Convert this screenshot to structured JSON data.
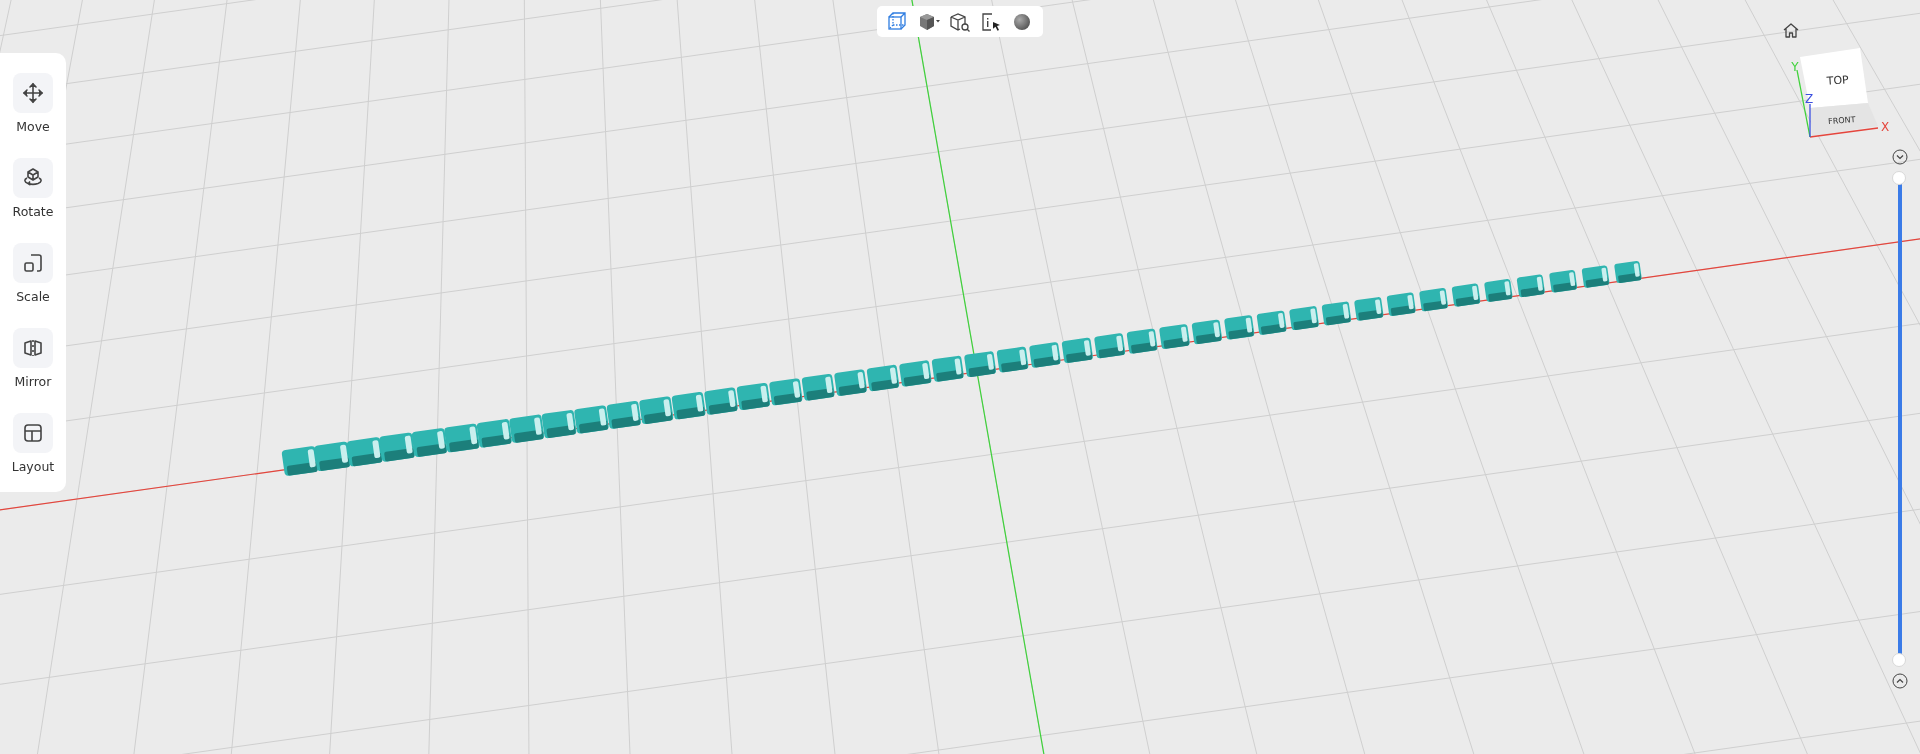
{
  "tools": [
    {
      "label": "Move"
    },
    {
      "label": "Rotate"
    },
    {
      "label": "Scale"
    },
    {
      "label": "Mirror"
    },
    {
      "label": "Layout"
    }
  ],
  "view_cube": {
    "faces": [
      "TOP",
      "FRONT"
    ],
    "axes": [
      "X",
      "Y",
      "Z"
    ]
  },
  "height_slider": {
    "level": 1
  }
}
